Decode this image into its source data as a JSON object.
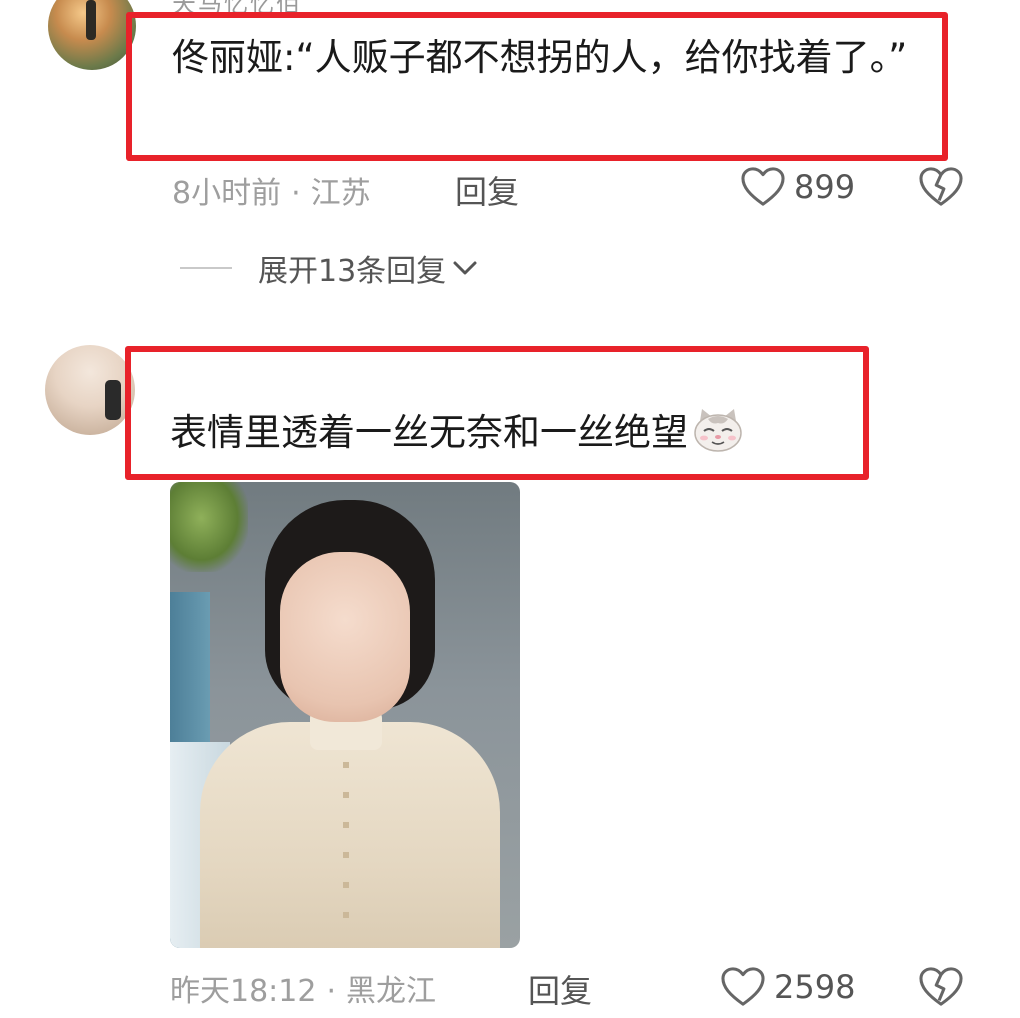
{
  "comment1": {
    "username_partial": "天马忆忆佰",
    "text": "佟丽娅:“人贩子都不想拐的人，给你找着了。”",
    "time": "8小时前",
    "location": "江苏",
    "separator": "·",
    "reply_label": "回复",
    "likes": "899",
    "expand_label": "展开13条回复"
  },
  "comment2": {
    "text": "表情里透着一丝无奈和一丝绝望",
    "emoji": "cat-emoji",
    "time": "昨天18:12",
    "location": "黑龙江",
    "separator": "·",
    "reply_label": "回复",
    "likes": "2598"
  },
  "colors": {
    "highlight": "#e8222a",
    "meta_text": "#9e9e9e",
    "action_text": "#555555"
  },
  "icons": {
    "like": "heart-outline-icon",
    "dislike": "broken-heart-icon",
    "expand": "chevron-down-icon"
  }
}
